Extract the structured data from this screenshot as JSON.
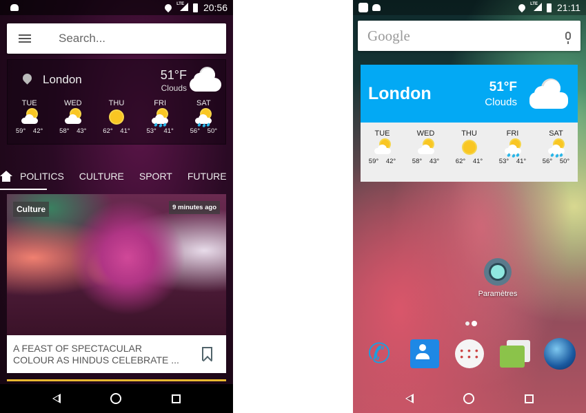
{
  "left_phone": {
    "status": {
      "time": "20:56",
      "network": "LTE"
    },
    "search": {
      "placeholder": "Search..."
    },
    "weather": {
      "city": "London",
      "temp": "51°F",
      "condition": "Clouds",
      "days": [
        {
          "name": "TUE",
          "icon": "partly-sunny",
          "high": "59°",
          "low": "42°"
        },
        {
          "name": "WED",
          "icon": "partly-sunny",
          "high": "58°",
          "low": "43°"
        },
        {
          "name": "THU",
          "icon": "sunny",
          "high": "62°",
          "low": "41°"
        },
        {
          "name": "FRI",
          "icon": "sun-rain",
          "high": "53°",
          "low": "41°"
        },
        {
          "name": "SAT",
          "icon": "sun-rain",
          "high": "56°",
          "low": "50°"
        }
      ]
    },
    "tabs": [
      {
        "label": "home",
        "icon": "home-icon",
        "selected": true
      },
      {
        "label": "POLITICS"
      },
      {
        "label": "CULTURE"
      },
      {
        "label": "SPORT"
      },
      {
        "label": "FUTURE"
      }
    ],
    "article": {
      "category": "Culture",
      "time": "9 minutes ago",
      "title": "A FEAST OF SPECTACULAR COLOUR AS HINDUS CELEBRATE ..."
    },
    "accent": "#e8b830"
  },
  "right_phone": {
    "status": {
      "time": "21:11",
      "network": "LTE"
    },
    "google": {
      "logo": "Google"
    },
    "weather": {
      "city": "London",
      "temp": "51°F",
      "condition": "Clouds",
      "header_color": "#03a9f4",
      "days": [
        {
          "name": "TUE",
          "icon": "partly-sunny",
          "high": "59°",
          "low": "42°"
        },
        {
          "name": "WED",
          "icon": "partly-sunny",
          "high": "58°",
          "low": "43°"
        },
        {
          "name": "THU",
          "icon": "sunny",
          "high": "62°",
          "low": "41°"
        },
        {
          "name": "FRI",
          "icon": "sun-rain",
          "high": "53°",
          "low": "41°"
        },
        {
          "name": "SAT",
          "icon": "sun-rain",
          "high": "56°",
          "low": "50°"
        }
      ]
    },
    "apps": [
      {
        "label": "Paramètres",
        "icon": "settings-icon"
      }
    ],
    "dock": [
      {
        "icon": "phone-icon"
      },
      {
        "icon": "contacts-icon"
      },
      {
        "icon": "app-drawer-icon"
      },
      {
        "icon": "messaging-icon"
      },
      {
        "icon": "browser-globe-icon"
      }
    ]
  }
}
